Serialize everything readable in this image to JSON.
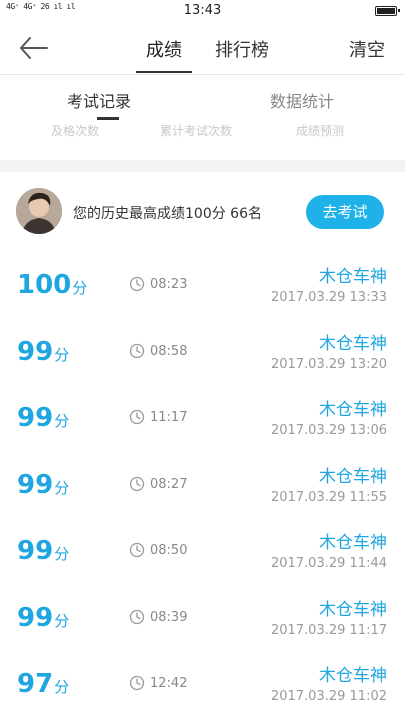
{
  "status_bar": {
    "signal_text": "4G⁺ 4G⁺ 26 ıl ıl",
    "time": "13:43"
  },
  "nav": {
    "tabs": [
      "成绩",
      "排行榜"
    ],
    "clear_label": "清空"
  },
  "sub_tabs": [
    "考试记录",
    "数据统计"
  ],
  "stats_labels": [
    "及格次数",
    "累计考试次数",
    "成绩预测"
  ],
  "best": {
    "summary": "您的历史最高成绩100分  66名",
    "exam_button": "去考试"
  },
  "records": [
    {
      "score": "100",
      "unit": "分",
      "duration": "08:23",
      "user": "木仓车神",
      "timestamp": "2017.03.29  13:33"
    },
    {
      "score": "99",
      "unit": "分",
      "duration": "08:58",
      "user": "木仓车神",
      "timestamp": "2017.03.29  13:20"
    },
    {
      "score": "99",
      "unit": "分",
      "duration": "11:17",
      "user": "木仓车神",
      "timestamp": "2017.03.29  13:06"
    },
    {
      "score": "99",
      "unit": "分",
      "duration": "08:27",
      "user": "木仓车神",
      "timestamp": "2017.03.29  11:55"
    },
    {
      "score": "99",
      "unit": "分",
      "duration": "08:50",
      "user": "木仓车神",
      "timestamp": "2017.03.29  11:44"
    },
    {
      "score": "99",
      "unit": "分",
      "duration": "08:39",
      "user": "木仓车神",
      "timestamp": "2017.03.29  11:17"
    },
    {
      "score": "97",
      "unit": "分",
      "duration": "12:42",
      "user": "木仓车神",
      "timestamp": "2017.03.29  11:02"
    }
  ],
  "colors": {
    "accent": "#1fa6e0",
    "button": "#1fb2e8"
  }
}
